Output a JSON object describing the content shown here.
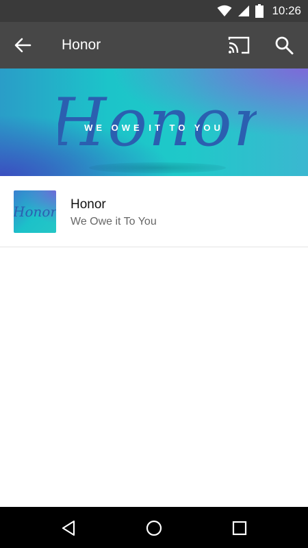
{
  "status_bar": {
    "time": "10:26",
    "icons": [
      "wifi-icon",
      "cell-signal-icon",
      "battery-icon"
    ]
  },
  "app_bar": {
    "title": "Honor",
    "icons": [
      "back-arrow-icon",
      "cast-icon",
      "search-icon"
    ]
  },
  "banner": {
    "script_text": "Honor",
    "tagline": "WE OWE IT TO YOU"
  },
  "list": {
    "items": [
      {
        "title": "Honor",
        "subtitle": "We Owe it To You",
        "thumbnail_text": "Honor"
      }
    ]
  },
  "nav_bar": {
    "icons": [
      "back-triangle-icon",
      "home-circle-icon",
      "recents-square-icon"
    ]
  },
  "colors": {
    "app_bar": "#474747",
    "status_bar": "#3a3a3a",
    "banner_teal": "#1cc4c9",
    "script_blue": "#2b5fb0"
  }
}
